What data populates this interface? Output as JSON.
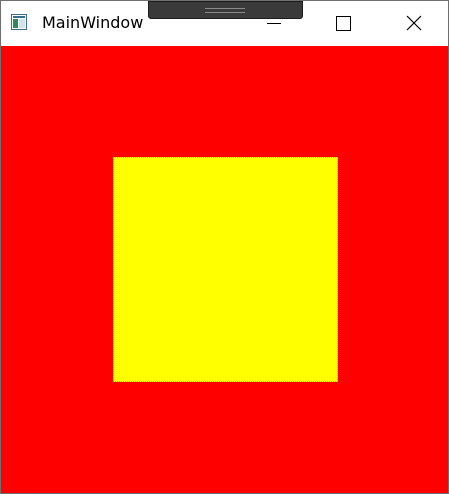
{
  "window": {
    "title": "MainWindow"
  },
  "icons": {
    "app": "app-window-icon",
    "minimize": "minimize-icon",
    "maximize": "maximize-icon",
    "close": "close-icon",
    "drag": "drag-grip-icon"
  },
  "colors": {
    "background": "#ff0000",
    "square": "#ffff00"
  }
}
